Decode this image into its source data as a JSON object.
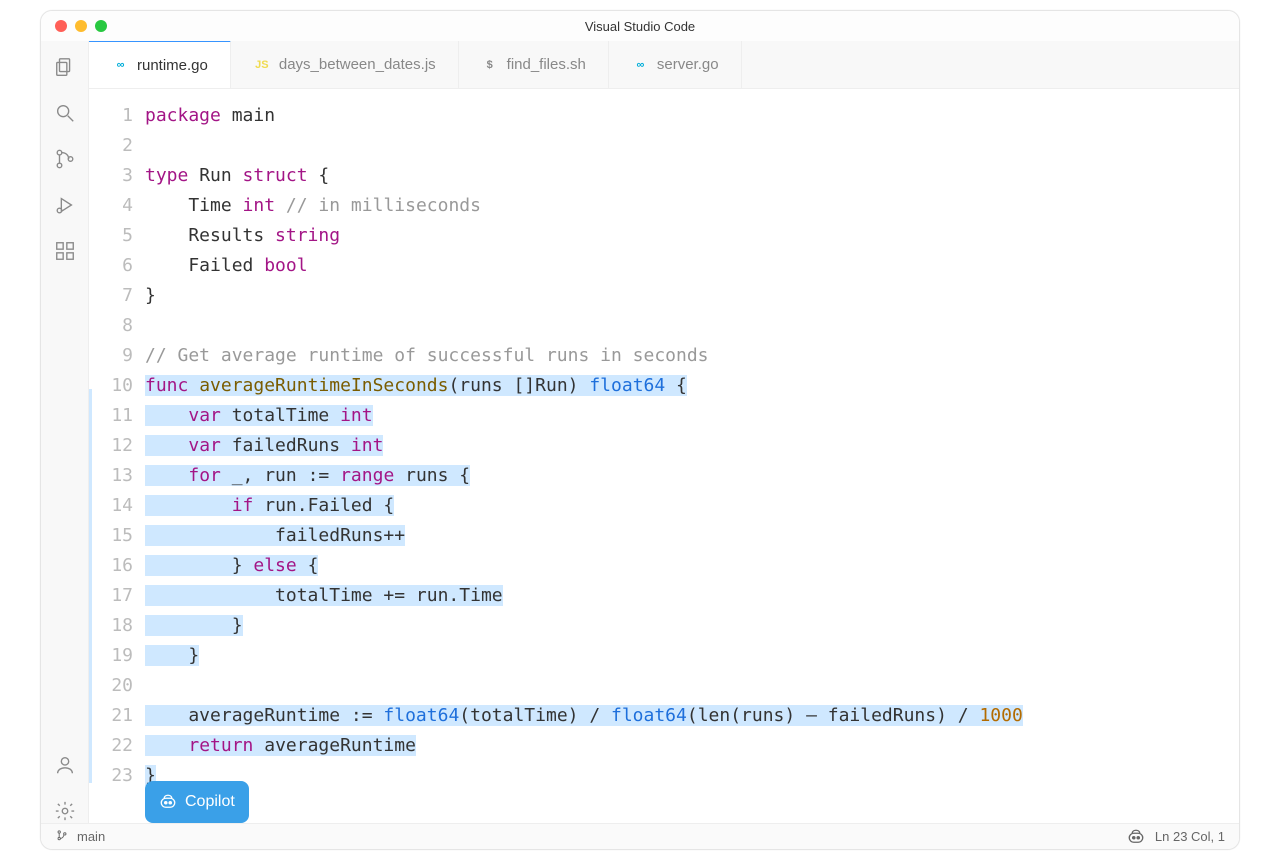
{
  "window": {
    "title": "Visual Studio Code"
  },
  "activity": [
    "files-icon",
    "search-icon",
    "source-control-icon",
    "run-debug-icon",
    "extensions-icon",
    "account-icon",
    "settings-gear-icon"
  ],
  "tabs": [
    {
      "label": "runtime.go",
      "icon": "go",
      "active": true
    },
    {
      "label": "days_between_dates.js",
      "icon": "js",
      "active": false
    },
    {
      "label": "find_files.sh",
      "icon": "sh",
      "active": false
    },
    {
      "label": "server.go",
      "icon": "go",
      "active": false
    }
  ],
  "copilot": {
    "label": "Copilot"
  },
  "status": {
    "branch": "main",
    "position": "Ln 23 Col, 1"
  },
  "code": {
    "lines": [
      {
        "n": 1,
        "t": [
          [
            "kw",
            "package"
          ],
          [
            "",
            " main"
          ]
        ]
      },
      {
        "n": 2,
        "t": [
          [
            "",
            ""
          ]
        ]
      },
      {
        "n": 3,
        "t": [
          [
            "kw",
            "type"
          ],
          [
            "",
            " Run "
          ],
          [
            "kw",
            "struct"
          ],
          [
            "",
            " {"
          ]
        ]
      },
      {
        "n": 4,
        "t": [
          [
            "",
            "    Time "
          ],
          [
            "ty",
            "int"
          ],
          [
            "",
            " "
          ],
          [
            "cm",
            "// in milliseconds"
          ]
        ]
      },
      {
        "n": 5,
        "t": [
          [
            "",
            "    Results "
          ],
          [
            "ty",
            "string"
          ]
        ]
      },
      {
        "n": 6,
        "t": [
          [
            "",
            "    Failed "
          ],
          [
            "ty",
            "bool"
          ]
        ]
      },
      {
        "n": 7,
        "t": [
          [
            "",
            "}"
          ]
        ]
      },
      {
        "n": 8,
        "t": [
          [
            "",
            ""
          ]
        ]
      },
      {
        "n": 9,
        "t": [
          [
            "cm",
            "// Get average runtime of successful runs in seconds"
          ]
        ]
      },
      {
        "n": 10,
        "hl": true,
        "t": [
          [
            "kw",
            "func"
          ],
          [
            "",
            " "
          ],
          [
            "fn",
            "averageRuntimeInSeconds"
          ],
          [
            "",
            "(runs []Run) "
          ],
          [
            "ret",
            "float64"
          ],
          [
            "",
            " {"
          ]
        ]
      },
      {
        "n": 11,
        "hl": true,
        "t": [
          [
            "",
            "    "
          ],
          [
            "kw",
            "var"
          ],
          [
            "",
            " totalTime "
          ],
          [
            "ty",
            "int"
          ]
        ]
      },
      {
        "n": 12,
        "hl": true,
        "t": [
          [
            "",
            "    "
          ],
          [
            "kw",
            "var"
          ],
          [
            "",
            " failedRuns "
          ],
          [
            "ty",
            "int"
          ]
        ]
      },
      {
        "n": 13,
        "hl": true,
        "t": [
          [
            "",
            "    "
          ],
          [
            "kw",
            "for"
          ],
          [
            "",
            " _, run := "
          ],
          [
            "kw",
            "range"
          ],
          [
            "",
            " runs {"
          ]
        ]
      },
      {
        "n": 14,
        "hl": true,
        "t": [
          [
            "",
            "        "
          ],
          [
            "kw",
            "if"
          ],
          [
            "",
            " run.Failed {"
          ]
        ]
      },
      {
        "n": 15,
        "hl": true,
        "t": [
          [
            "",
            "            failedRuns++"
          ]
        ]
      },
      {
        "n": 16,
        "hl": true,
        "t": [
          [
            "",
            "        } "
          ],
          [
            "kw",
            "else"
          ],
          [
            "",
            " {"
          ]
        ]
      },
      {
        "n": 17,
        "hl": true,
        "t": [
          [
            "",
            "            totalTime += run.Time"
          ]
        ]
      },
      {
        "n": 18,
        "hl": true,
        "t": [
          [
            "",
            "        }"
          ]
        ]
      },
      {
        "n": 19,
        "hl": true,
        "t": [
          [
            "",
            "    }"
          ]
        ]
      },
      {
        "n": 20,
        "hl": false,
        "t": [
          [
            "",
            ""
          ]
        ]
      },
      {
        "n": 21,
        "hl": true,
        "t": [
          [
            "",
            "    averageRuntime := "
          ],
          [
            "ret",
            "float64"
          ],
          [
            "",
            "(totalTime) / "
          ],
          [
            "ret",
            "float64"
          ],
          [
            "",
            "(len(runs) – failedRuns) / "
          ],
          [
            "num",
            "1000"
          ]
        ]
      },
      {
        "n": 22,
        "hl": true,
        "t": [
          [
            "",
            "    "
          ],
          [
            "kw",
            "return"
          ],
          [
            "",
            " averageRuntime"
          ]
        ]
      },
      {
        "n": 23,
        "hl": true,
        "t": [
          [
            "",
            "}"
          ]
        ]
      }
    ]
  }
}
